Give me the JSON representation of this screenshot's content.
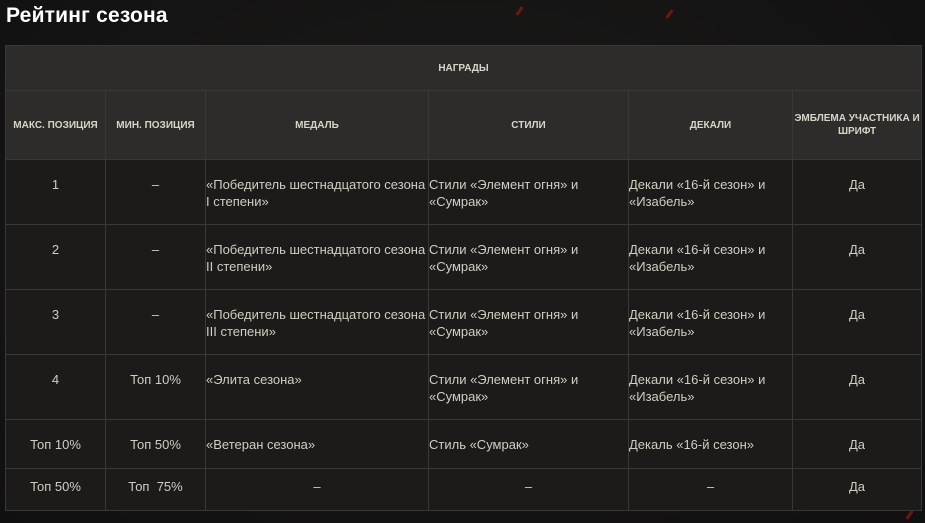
{
  "page": {
    "title": "Рейтинг сезона"
  },
  "table": {
    "group_header": "Награды",
    "columns": [
      "Макс. позиция",
      "Мин. позиция",
      "Медаль",
      "Стили",
      "Декали",
      "Эмблема участника и шрифт"
    ],
    "rows": [
      [
        "1",
        "–",
        "«Победитель шестнадцатого сезона I степени»",
        "Стили «Элемент огня» и «Сумрак»",
        "Декали «16-й сезон» и «Изабель»",
        "Да"
      ],
      [
        "2",
        "–",
        "«Победитель шестнадцатого сезона II степени»",
        "Стили «Элемент огня» и «Сумрак»",
        "Декали «16-й сезон» и «Изабель»",
        "Да"
      ],
      [
        "3",
        "–",
        "«Победитель шестнадцатого сезона III степени»",
        "Стили «Элемент огня» и «Сумрак»",
        "Декали «16-й сезон» и «Изабель»",
        "Да"
      ],
      [
        "4",
        "Топ 10%",
        "«Элита сезона»",
        "Стили «Элемент огня» и «Сумрак»",
        "Декали «16-й сезон» и «Изабель»",
        "Да"
      ],
      [
        "Топ 10%",
        "Топ 50%",
        "«Ветеран сезона»",
        "Стиль «Сумрак»",
        "Декаль «16-й сезон»",
        "Да"
      ],
      [
        "Топ 50%",
        "Топ  75%",
        "–",
        "–",
        "–",
        "Да"
      ]
    ]
  },
  "colors": {
    "background": "#151414",
    "header_cell": "#2d2c2a",
    "body_cell": "#1c1b1a",
    "border": "#3a3836",
    "title_text": "#ffffff",
    "body_text": "#d2cdc2",
    "ember": "#8a1a12"
  }
}
